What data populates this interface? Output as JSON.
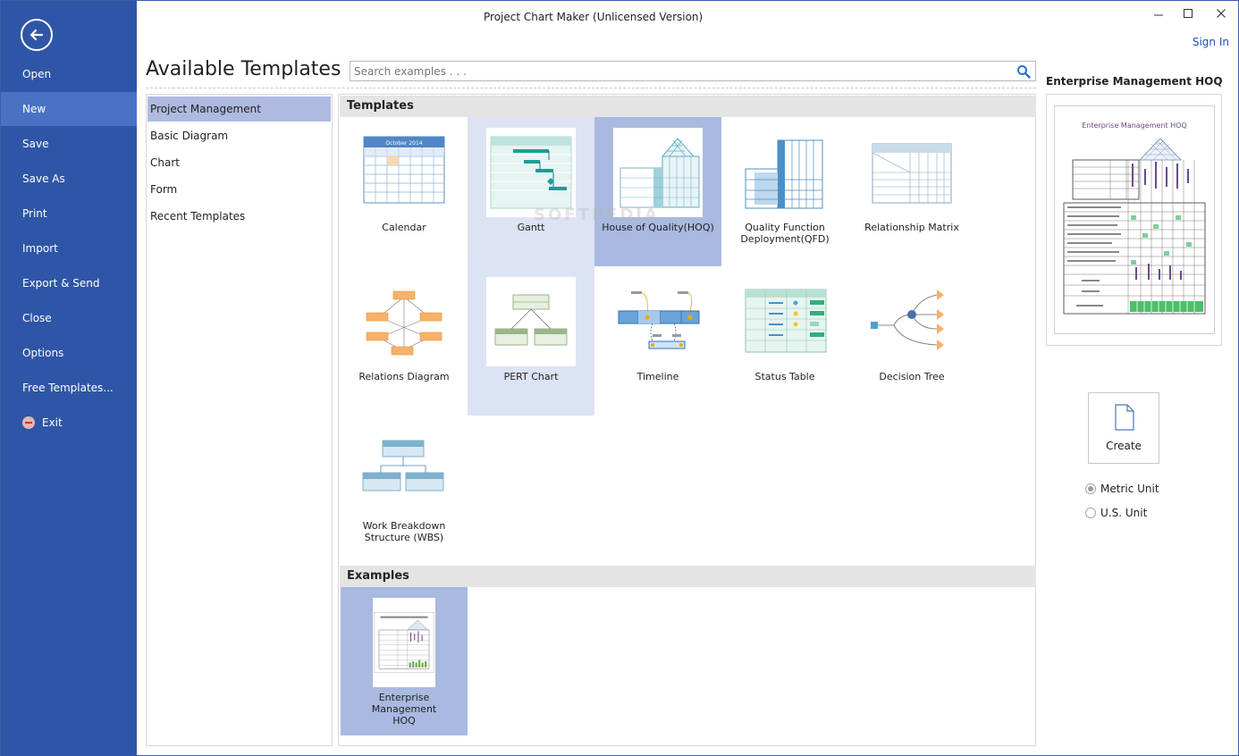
{
  "window": {
    "title": "Project Chart Maker (Unlicensed Version)",
    "controls": [
      "minimize-icon",
      "maximize-icon",
      "close-icon"
    ],
    "sign_in": "Sign In"
  },
  "sidebar": {
    "back_icon": "back-arrow-icon",
    "items": [
      {
        "label": "Open"
      },
      {
        "label": "New",
        "active": true
      },
      {
        "label": "Save"
      },
      {
        "label": "Save As"
      },
      {
        "label": "Print"
      },
      {
        "label": "Import"
      },
      {
        "label": "Export & Send"
      },
      {
        "label": "Close"
      },
      {
        "label": "Options"
      },
      {
        "label": "Free Templates..."
      },
      {
        "label": "Exit",
        "icon": "exit-icon"
      }
    ],
    "color": "#2f56a6",
    "active_color": "#4a72c4"
  },
  "main": {
    "title": "Available Templates",
    "search": {
      "placeholder": "Search examples . . .",
      "value": "",
      "icon": "search-icon"
    }
  },
  "categories": [
    {
      "label": "Project Management",
      "active": true
    },
    {
      "label": "Basic Diagram"
    },
    {
      "label": "Chart"
    },
    {
      "label": "Form"
    },
    {
      "label": "Recent Templates"
    }
  ],
  "templates_section": {
    "heading": "Templates",
    "items": [
      {
        "label": "Calendar",
        "calendar_month": "October 2014"
      },
      {
        "label": "Gantt"
      },
      {
        "label": "House of Quality(HOQ)"
      },
      {
        "label": "Quality Function Deployment(QFD)"
      },
      {
        "label": "Relationship Matrix"
      },
      {
        "label": "Relations Diagram"
      },
      {
        "label": "PERT Chart"
      },
      {
        "label": "Timeline"
      },
      {
        "label": "Status Table"
      },
      {
        "label": "Decision Tree"
      },
      {
        "label": "Work Breakdown Structure (WBS)"
      }
    ]
  },
  "examples_section": {
    "heading": "Examples",
    "items": [
      {
        "label": "Enterprise Management HOQ"
      }
    ]
  },
  "preview": {
    "title": "Enterprise Management HOQ",
    "page_heading": "Enterprise Management HOQ",
    "create_label": "Create",
    "create_icon": "document-icon",
    "units": [
      {
        "label": "Metric Unit",
        "checked": true
      },
      {
        "label": "U.S. Unit",
        "checked": false
      }
    ]
  },
  "watermark": "SOFTPEDIA",
  "colors": {
    "accent": "#2f56a6",
    "selection": "#aebadf",
    "link": "#1f4fb5"
  }
}
